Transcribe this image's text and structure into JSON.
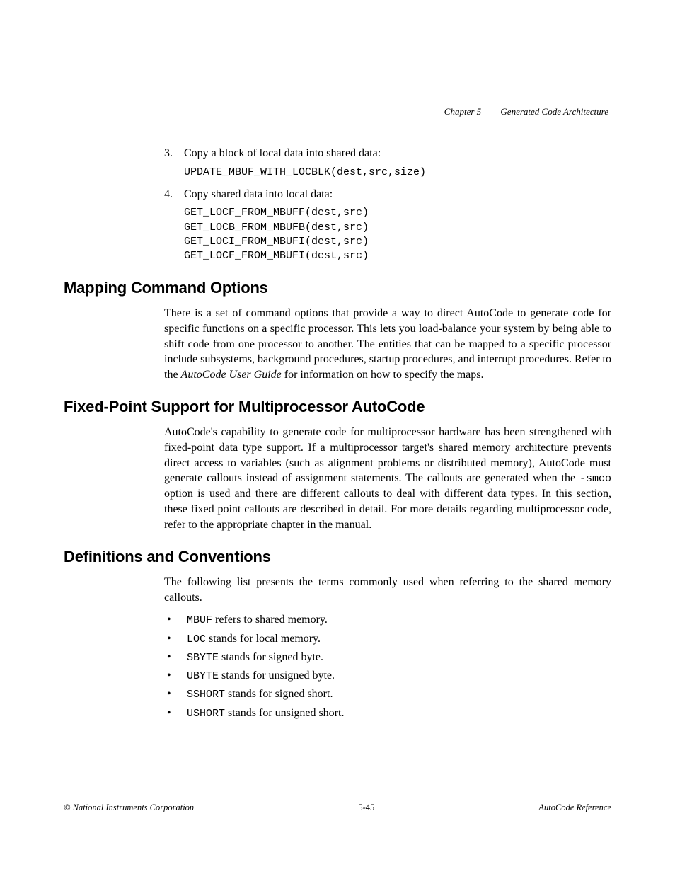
{
  "header": {
    "chapter": "Chapter 5",
    "title": "Generated Code Architecture"
  },
  "list1": {
    "num3": "3.",
    "text3": "Copy a block of local data into shared data:",
    "code3": "UPDATE_MBUF_WITH_LOCBLK(dest,src,size)",
    "num4": "4.",
    "text4": "Copy shared data into local data:",
    "code4": "GET_LOCF_FROM_MBUFF(dest,src)\nGET_LOCB_FROM_MBUFB(dest,src)\nGET_LOCI_FROM_MBUFI(dest,src)\nGET_LOCF_FROM_MBUFI(dest,src)"
  },
  "sec1": {
    "heading": "Mapping Command Options",
    "p1a": "There is a set of command options that provide a way to direct AutoCode to generate code for specific functions on a specific processor. This lets you load-balance your system by being able to shift code from one processor to another. The entities that can be mapped to a specific processor include subsystems, background procedures, startup procedures, and interrupt procedures. Refer to the ",
    "p1i": "AutoCode User Guide",
    "p1b": " for information on how to specify the maps."
  },
  "sec2": {
    "heading": "Fixed-Point Support for Multiprocessor AutoCode",
    "p1a": "AutoCode's capability to generate code for multiprocessor hardware has been strengthened with fixed-point data type support. If a multiprocessor target's shared memory architecture prevents direct access to variables (such as alignment problems or distributed memory), AutoCode must generate callouts instead of assignment statements. The callouts are generated when the ",
    "p1m": "-smco",
    "p1b": " option is used and there are different callouts to deal with different data types. In this section, these fixed point callouts are described in detail. For more details regarding multiprocessor code, refer to the appropriate chapter in the manual."
  },
  "sec3": {
    "heading": "Definitions and Conventions",
    "intro": "The following list presents the terms commonly used when referring to the shared memory callouts.",
    "bullets": [
      {
        "code": "MBUF",
        "text": " refers to shared memory."
      },
      {
        "code": "LOC",
        "text": " stands for local memory."
      },
      {
        "code": "SBYTE",
        "text": " stands for signed byte."
      },
      {
        "code": "UBYTE",
        "text": " stands for unsigned byte."
      },
      {
        "code": "SSHORT",
        "text": " stands for signed short."
      },
      {
        "code": "USHORT",
        "text": " stands for unsigned short."
      }
    ]
  },
  "footer": {
    "left": "© National Instruments Corporation",
    "center": "5-45",
    "right": "AutoCode Reference"
  }
}
